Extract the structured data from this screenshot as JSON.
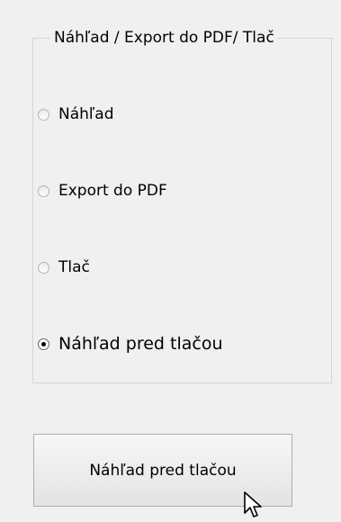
{
  "group": {
    "legend": "Náhľad / Export do PDF/ Tlač",
    "options": [
      {
        "label": "Náhľad",
        "checked": false
      },
      {
        "label": "Export do PDF",
        "checked": false
      },
      {
        "label": "Tlač",
        "checked": false
      },
      {
        "label": "Náhľad pred tlačou",
        "checked": true
      }
    ]
  },
  "button": {
    "label": "Náhľad pred tlačou"
  },
  "cursor": {
    "icon": "arrow-cursor-icon"
  }
}
